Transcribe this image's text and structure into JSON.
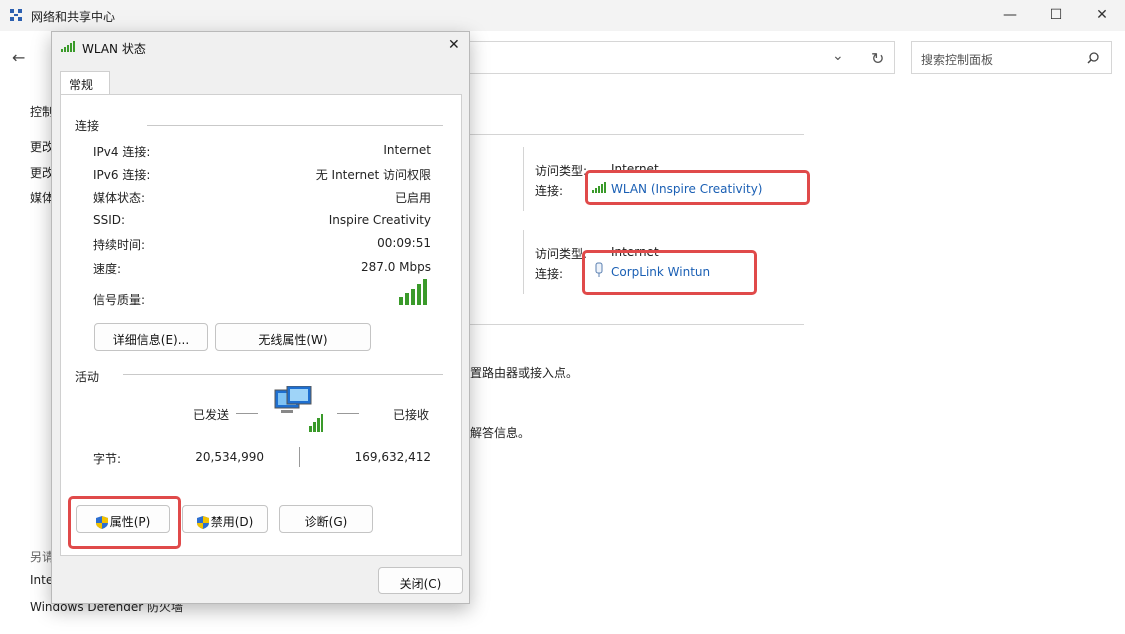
{
  "window": {
    "title": "网络和共享中心",
    "minimize_glyph": "—",
    "maximize_glyph": "☐",
    "close_glyph": "✕",
    "back_glyph": "←"
  },
  "toolbar": {
    "search_placeholder": "搜索控制面板",
    "dropdown_glyph": "⌄",
    "refresh_glyph": "↻",
    "search_glyph": "⚲"
  },
  "sidebar": {
    "items": [
      "控制",
      "更改",
      "更改",
      "媒体"
    ],
    "see_also_label": "另请",
    "see_also_items": [
      "Inte",
      "Windows Defender 防火墙"
    ]
  },
  "networks": [
    {
      "access_type_label": "访问类型:",
      "access_type_value": "Internet",
      "connection_label": "连接:",
      "connection_value": "WLAN (Inspire Creativity)"
    },
    {
      "access_type_label": "访问类型:",
      "access_type_value": "Internet",
      "connection_label": "连接:",
      "connection_value": "CorpLink Wintun"
    }
  ],
  "partial_text": [
    "置路由器或接入点。",
    "解答信息。"
  ],
  "dialog": {
    "title": "WLAN 状态",
    "close_glyph": "✕",
    "tab": "常规",
    "connection_section": "连接",
    "rows": [
      {
        "label": "IPv4 连接:",
        "value": "Internet"
      },
      {
        "label": "IPv6 连接:",
        "value": "无 Internet 访问权限"
      },
      {
        "label": "媒体状态:",
        "value": "已启用"
      },
      {
        "label": "SSID:",
        "value": "Inspire Creativity"
      },
      {
        "label": "持续时间:",
        "value": "00:09:51"
      },
      {
        "label": "速度:",
        "value": "287.0 Mbps"
      }
    ],
    "signal_label": "信号质量:",
    "signal_bars": 5,
    "details_button": "详细信息(E)...",
    "wireless_button": "无线属性(W)",
    "activity_section": "活动",
    "sent_label": "已发送",
    "received_label": "已接收",
    "bytes_label": "字节:",
    "bytes_sent": "20,534,990",
    "bytes_received": "169,632,412",
    "properties_button": "属性(P)",
    "disable_button": "禁用(D)",
    "diagnose_button": "诊断(G)",
    "close_button": "关闭(C)"
  },
  "colors": {
    "highlight": "#e04a4a",
    "link": "#1a5fb4",
    "signal": "#3a9a2a"
  }
}
